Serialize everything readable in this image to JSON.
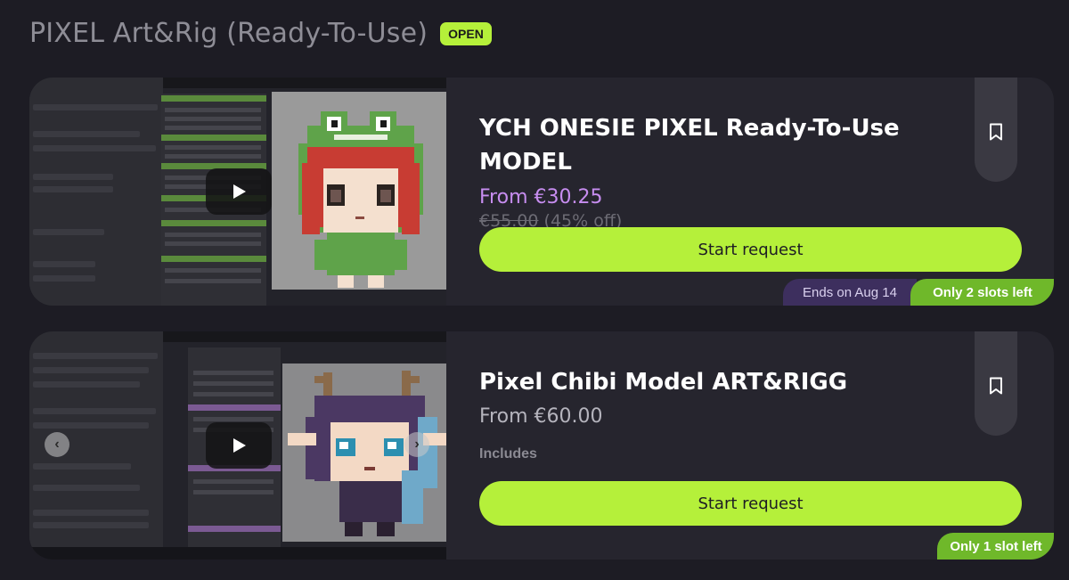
{
  "section": {
    "title": "PIXEL Art&Rig (Ready-To-Use)",
    "status_badge": "OPEN"
  },
  "colors": {
    "background": "#1d1c24",
    "card": "#26252e",
    "accent_green": "#b5f03a",
    "price_purple": "#c78df0",
    "ends_tag": "#3d2f5e",
    "slots_tag": "#6fb82a"
  },
  "offers": [
    {
      "title": "YCH ONESIE PIXEL Ready-To-Use MODEL",
      "price": "From €30.25",
      "original_price": "€55.00",
      "discount": "(45% off)",
      "button_label": "Start request",
      "ends_label": "Ends on Aug 14",
      "slots_label": "Only 2 slots left",
      "media_icon": "play-icon",
      "bookmark_icon": "bookmark-icon"
    },
    {
      "title": "Pixel Chibi Model ART&RIGG",
      "price": "From €60.00",
      "includes_label": "Includes",
      "button_label": "Start request",
      "slots_label": "Only 1 slot left",
      "media_icon": "play-icon",
      "bookmark_icon": "bookmark-icon",
      "carousel_prev": "‹",
      "carousel_next": "›"
    }
  ]
}
